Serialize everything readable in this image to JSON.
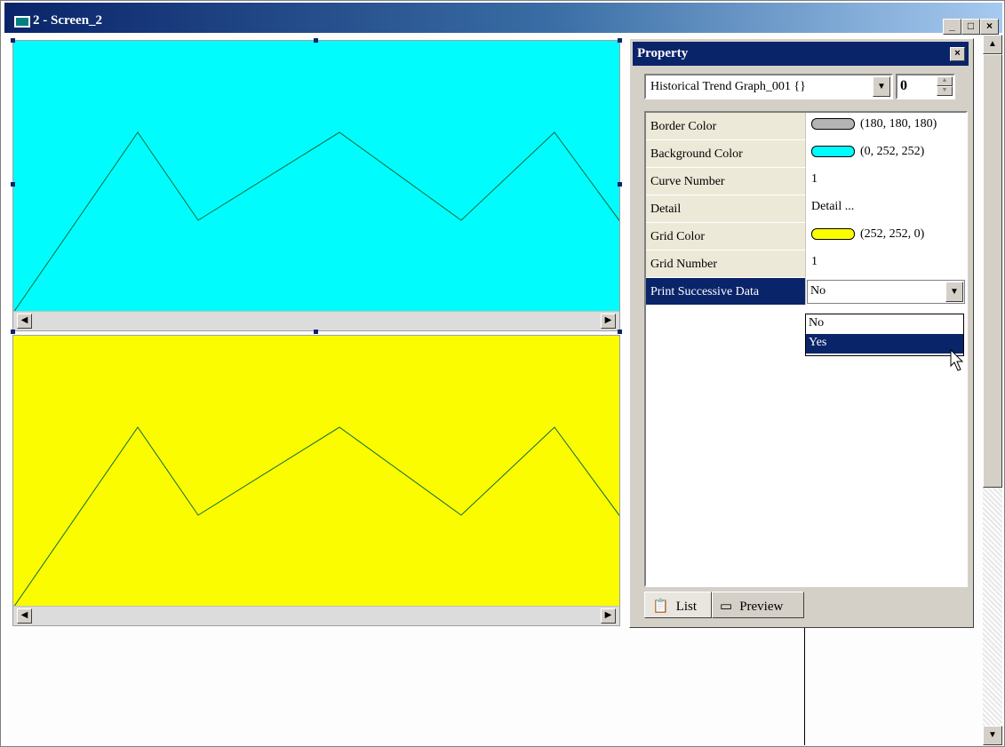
{
  "window": {
    "title": "2 - Screen_2"
  },
  "window_controls": {
    "minimize": "_",
    "maximize": "□",
    "close": "×"
  },
  "colors": {
    "graph1_background": "#00fcfc",
    "graph2_background": "#fcfc00",
    "border": "#b4b4b4",
    "curve": "#0a6a3a"
  },
  "graphs": [
    {
      "name": "trend-graph-1",
      "background": "#00fcfc"
    },
    {
      "name": "trend-graph-2",
      "background": "#fcfc00"
    }
  ],
  "property": {
    "title": "Property",
    "close": "×",
    "object_select": "Historical Trend Graph_001 {}",
    "index": "0",
    "rows": [
      {
        "name": "Border Color",
        "value": "(180, 180, 180)",
        "swatch": "#b4b4b4"
      },
      {
        "name": "Background Color",
        "value": "(0, 252, 252)",
        "swatch": "#00fcfc"
      },
      {
        "name": "Curve Number",
        "value": "1"
      },
      {
        "name": "Detail",
        "value": "Detail ..."
      },
      {
        "name": "Grid Color",
        "value": "(252, 252, 0)",
        "swatch": "#fcfc00"
      },
      {
        "name": "Grid Number",
        "value": "1"
      },
      {
        "name": "Print Successive Data",
        "value": "No"
      }
    ],
    "dropdown_options": [
      "No",
      "Yes"
    ],
    "highlighted_option": "Yes",
    "tabs": {
      "list": "List",
      "preview": "Preview"
    }
  }
}
